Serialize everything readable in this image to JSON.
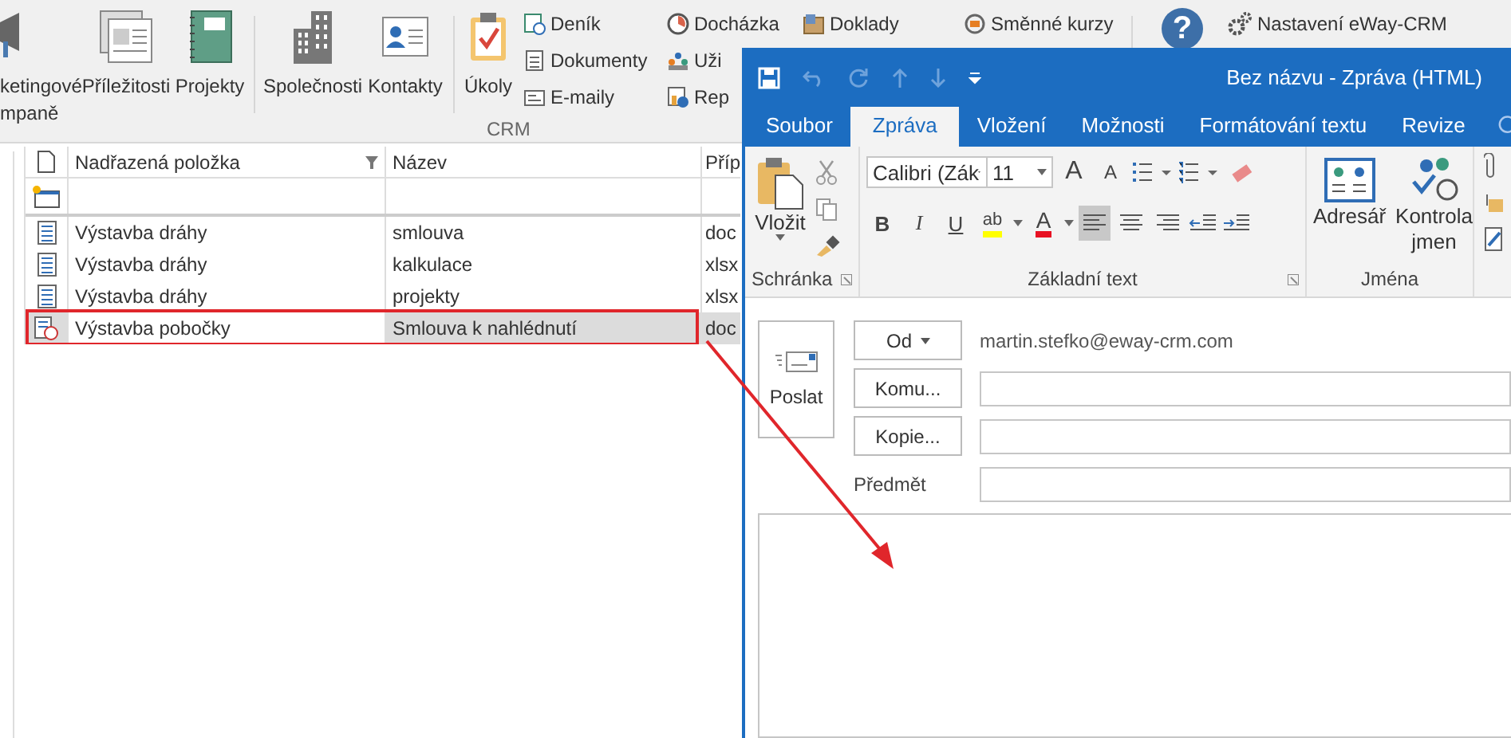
{
  "crm_ribbon": {
    "large_buttons": [
      "ketingové mpaně",
      "Příležitosti",
      "Projekty",
      "Společnosti",
      "Kontakty",
      "Úkoly"
    ],
    "small_columns": [
      [
        "Deník",
        "Dokumenty",
        "E-maily"
      ],
      [
        "Docházka",
        "Uži",
        "Rep"
      ],
      [
        "Doklady"
      ],
      [
        "Směnné kurzy"
      ]
    ],
    "group_label": "CRM",
    "help_button": "?",
    "settings_button": "Nastavení eWay-CRM"
  },
  "grid": {
    "columns": [
      "Nadřazená položka",
      "Název",
      "Příp"
    ],
    "rows": [
      {
        "parent": "Výstavba dráhy",
        "name": "smlouva",
        "ext": "doc",
        "selected": false,
        "annotated": false
      },
      {
        "parent": "Výstavba dráhy",
        "name": "kalkulace",
        "ext": "xlsx",
        "selected": false,
        "annotated": false
      },
      {
        "parent": "Výstavba dráhy",
        "name": "projekty",
        "ext": "xlsx",
        "selected": false,
        "annotated": false
      },
      {
        "parent": "Výstavba pobočky",
        "name": "Smlouva k nahlédnutí",
        "ext": "doc",
        "selected": true,
        "annotated": true
      }
    ]
  },
  "message_window": {
    "title": "Bez názvu - Zpráva (HTML)",
    "tabs": [
      {
        "label": "Soubor",
        "selected": false
      },
      {
        "label": "Zpráva",
        "selected": true
      },
      {
        "label": "Vložení",
        "selected": false
      },
      {
        "label": "Možnosti",
        "selected": false
      },
      {
        "label": "Formátování textu",
        "selected": false
      },
      {
        "label": "Revize",
        "selected": false
      }
    ],
    "ribbon": {
      "paste_button": "Vložit",
      "font_name": "Calibri (Zák",
      "font_size": "11",
      "grow_font": "A",
      "shrink_font": "A",
      "bold": "B",
      "italic": "I",
      "underline": "U",
      "highlight": "ab",
      "font_color": "A",
      "align_buttons": [
        {
          "selected": true
        },
        {
          "selected": false
        },
        {
          "selected": false
        }
      ],
      "group_labels": [
        "Schránka",
        "Základní text",
        "Jména"
      ],
      "address_book": "Adresář",
      "check_names": "Kontrola jmen"
    },
    "compose": {
      "send_button": "Poslat",
      "from_button": "Od",
      "from_address": "martin.stefko@eway-crm.com",
      "to_button": "Komu...",
      "cc_button": "Kopie...",
      "subject_label": "Předmět"
    }
  }
}
